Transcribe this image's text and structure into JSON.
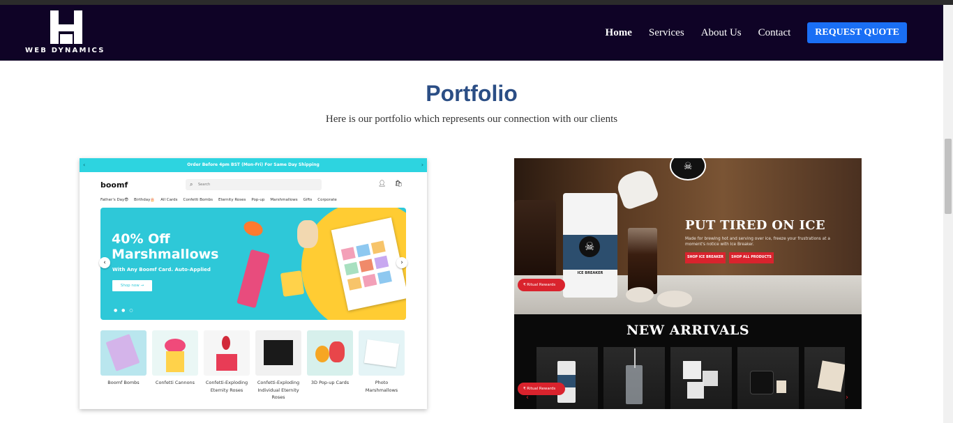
{
  "brand": {
    "name": "WEB DYNAMICS"
  },
  "nav": {
    "links": [
      "Home",
      "Services",
      "About Us",
      "Contact"
    ],
    "cta": "REQUEST QUOTE"
  },
  "section": {
    "title": "Portfolio",
    "subtitle": "Here is our portfolio which represents our connection with our clients"
  },
  "portfolio": [
    {
      "site": "boomf",
      "banner": "Order Before 4pm BST (Mon-Fri) For Same Day Shipping",
      "search_placeholder": "Search",
      "categories": [
        "Father's Day😎",
        "Birthday🎂",
        "All Cards",
        "Confetti Bombs",
        "Eternity Roses",
        "Pop-up",
        "Marshmallows",
        "Gifts",
        "Corporate"
      ],
      "hero_heading_1": "40% Off",
      "hero_heading_2": "Marshmallows",
      "hero_sub": "With Any Boomf Card. Auto-Applied",
      "hero_button": "Shop now →",
      "tiles": [
        {
          "label": "Boomf Bombs",
          "color": "#b9e6ee"
        },
        {
          "label": "Confetti Cannons",
          "color": "#eaf7f5"
        },
        {
          "label": "Confetti-Exploding Eternity Roses",
          "color": "#f6f6f6"
        },
        {
          "label": "Confetti-Exploding Individual Eternity Roses",
          "color": "#f1f1f1"
        },
        {
          "label": "3D Pop-up Cards",
          "color": "#d7f0ec"
        },
        {
          "label": "Photo Marshmallows",
          "color": "#e4f4f6"
        }
      ]
    },
    {
      "site": "Death Wish Coffee",
      "bag_label": "ICE BREAKER",
      "headline": "PUT TIRED ON ICE",
      "description": "Made for brewing hot and serving over ice, freeze your frustrations at a moment's notice with Ice Breaker.",
      "button_1": "SHOP ICE BREAKER",
      "button_2": "SHOP ALL PRODUCTS",
      "rewards_label": "Ritual Rewards",
      "section_title": "NEW ARRIVALS"
    }
  ],
  "colors": {
    "nav_bg": "#0f0326",
    "accent": "#1a6ff5",
    "title": "#2b4e85",
    "boomf_teal": "#2ec8d8",
    "dw_red": "#d9232d"
  }
}
